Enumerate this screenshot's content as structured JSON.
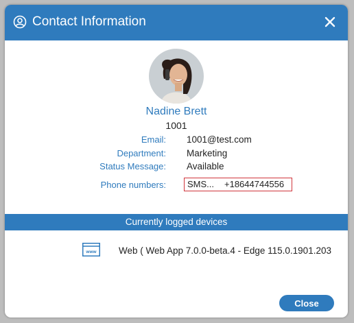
{
  "dialog": {
    "title": "Contact Information",
    "header_icon": "contact-icon",
    "close_icon": "close-icon"
  },
  "contact": {
    "name": "Nadine Brett",
    "extension": "1001",
    "fields": [
      {
        "label": "Email:",
        "value": "1001@test.com"
      },
      {
        "label": "Department:",
        "value": "Marketing"
      },
      {
        "label": "Status Message:",
        "value": "Available"
      }
    ],
    "phones_label": "Phone numbers:",
    "phone": {
      "type": "SMS...",
      "number": "+18644744556"
    }
  },
  "devices": {
    "section_title": "Currently logged devices",
    "icon": "web-browser-icon",
    "icon_text": "www",
    "items": [
      {
        "label": "Web ( Web App 7.0.0-beta.4 - Edge 115.0.1901.203"
      }
    ]
  },
  "footer": {
    "close_label": "Close"
  },
  "colors": {
    "accent": "#2f7bbd",
    "highlight_border": "#d0343a"
  }
}
